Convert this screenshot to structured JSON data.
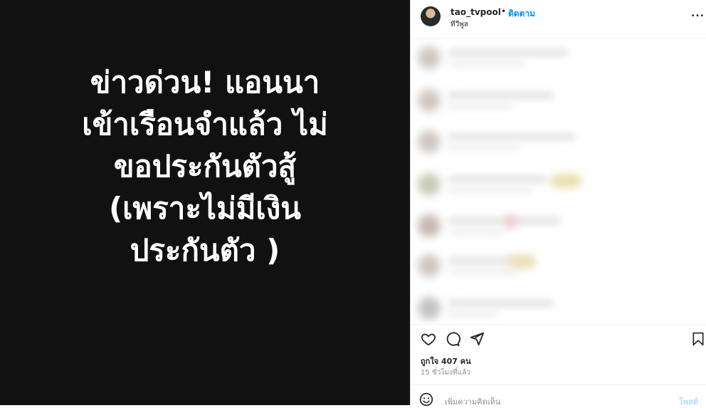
{
  "media": {
    "headline_lines": [
      "ข่าวด่วน! แอนนา",
      "เข้าเรือนจำแล้ว ไม่",
      "ขอประกันตัวสู้",
      "(เพราะไม่มีเงิน",
      "ประกันตัว )"
    ]
  },
  "header": {
    "username": "tao_tvpool",
    "separator": "•",
    "follow_label": "ติดตาม",
    "sublabel": "ทีวีพูล",
    "more_label": "..."
  },
  "post": {
    "likes_label": "ถูกใจ 407 คน",
    "time_label": "15 ชั่วโมงที่แล้ว"
  },
  "composer": {
    "placeholder": "เพิ่มความคิดเห็น",
    "post_label": "โพสต์"
  },
  "colors": {
    "accent": "#0095f6",
    "media_background": "#111111",
    "text": "#262626",
    "muted": "#8e8e8e"
  },
  "icons": [
    "heart-icon",
    "comment-icon",
    "share-icon",
    "bookmark-icon",
    "emoji-icon",
    "more-icon"
  ]
}
